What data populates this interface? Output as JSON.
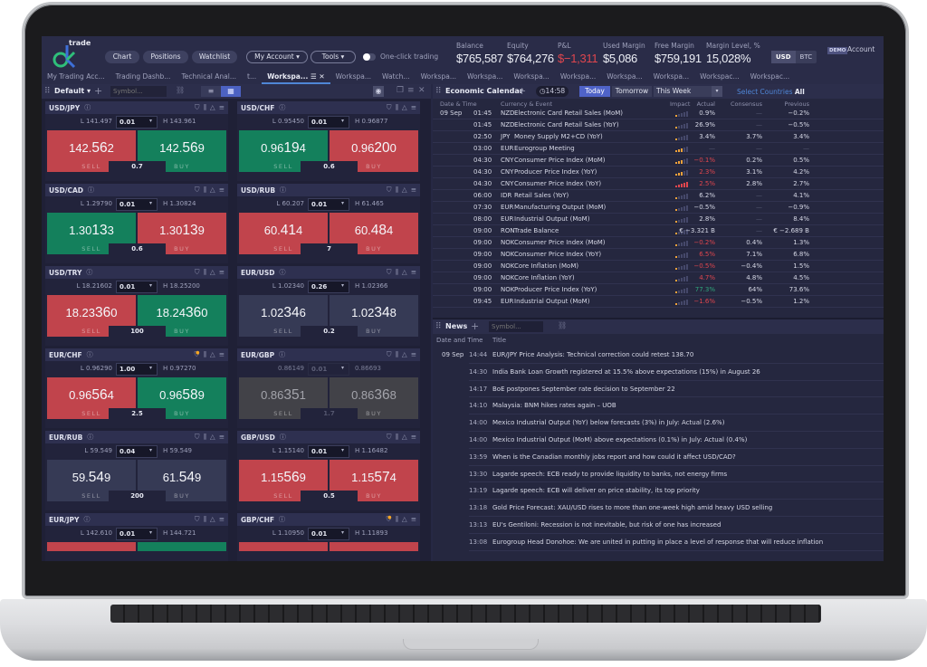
{
  "app": {
    "logo_text": "trade",
    "nav_buttons": [
      "Chart",
      "Positions",
      "Watchlist"
    ],
    "menus": [
      {
        "label": "My Account",
        "caret": "▾"
      },
      {
        "label": "Tools",
        "caret": "▾"
      }
    ],
    "one_click_label": "One-click trading",
    "one_click_enabled": false,
    "metrics": [
      {
        "label": "Balance",
        "value": "$765,587",
        "negative": false
      },
      {
        "label": "Equity",
        "value": "$764,276",
        "negative": false
      },
      {
        "label": "P&L",
        "value": "$−1,311",
        "negative": true
      },
      {
        "label": "Used Margin",
        "value": "$5,086",
        "negative": false
      },
      {
        "label": "Free Margin",
        "value": "$759,191",
        "negative": false
      },
      {
        "label": "Margin Level, %",
        "value": "15,028%",
        "negative": false
      }
    ],
    "currency_options": [
      "USD",
      "BTC"
    ],
    "currency_selected": "USD",
    "demo_badge": "DEMO",
    "account_label": "Account",
    "colors": {
      "accent": "#4f63c8",
      "buy_green": "#14805c",
      "sell_red": "#c1444c",
      "negative": "#e0464e",
      "positive": "#2fa77c",
      "impact": "#f0a23a"
    }
  },
  "tabs": [
    {
      "label": "My Trading Acc...",
      "active": false
    },
    {
      "label": "Trading Dashb...",
      "active": false
    },
    {
      "label": "Technical Anal...",
      "active": false
    },
    {
      "label": "t...",
      "active": false
    },
    {
      "label": "Workspa...",
      "active": true
    },
    {
      "label": "Workspa...",
      "active": false
    },
    {
      "label": "Watch...",
      "active": false
    },
    {
      "label": "Workspa...",
      "active": false
    },
    {
      "label": "Workspa...",
      "active": false
    },
    {
      "label": "Workspa...",
      "active": false
    },
    {
      "label": "Workspa...",
      "active": false
    },
    {
      "label": "Workspa...",
      "active": false
    },
    {
      "label": "Workspa...",
      "active": false
    },
    {
      "label": "Workspac...",
      "active": false
    },
    {
      "label": "Workspac...",
      "active": false
    }
  ],
  "watchlist": {
    "name": "Default",
    "symbol_placeholder": "Symbol...",
    "quotes": [
      {
        "pair": "USD/JPY",
        "low": "L 141.497",
        "high": "H 143.961",
        "qty": "0.01",
        "sell": [
          "142.",
          "56",
          "2"
        ],
        "buy": [
          "142.",
          "56",
          "9"
        ],
        "sell_color": "red",
        "buy_color": "green",
        "spread": "0.7",
        "alert_dot": false,
        "disabled": false
      },
      {
        "pair": "USD/CHF",
        "low": "L 0.95450",
        "high": "H 0.96877",
        "qty": "0.01",
        "sell": [
          "0.96",
          "19",
          "4"
        ],
        "buy": [
          "0.96",
          "20",
          "0"
        ],
        "sell_color": "green",
        "buy_color": "red",
        "spread": "0.6",
        "alert_dot": false,
        "disabled": false
      },
      {
        "pair": "USD/CAD",
        "low": "L 1.29790",
        "high": "H 1.30824",
        "qty": "0.01",
        "sell": [
          "1.30",
          "13",
          "3"
        ],
        "buy": [
          "1.30",
          "13",
          "9"
        ],
        "sell_color": "green",
        "buy_color": "red",
        "spread": "0.6",
        "alert_dot": false,
        "disabled": false
      },
      {
        "pair": "USD/RUB",
        "low": "L 60.207",
        "high": "H 61.465",
        "qty": "0.01",
        "sell": [
          "60.",
          "41",
          "4"
        ],
        "buy": [
          "60.",
          "48",
          "4"
        ],
        "sell_color": "red",
        "buy_color": "red",
        "spread": "7",
        "alert_dot": false,
        "disabled": false
      },
      {
        "pair": "USD/TRY",
        "low": "L 18.21602",
        "high": "H 18.25200",
        "qty": "0.01",
        "sell": [
          "18.23",
          "36",
          "0"
        ],
        "buy": [
          "18.24",
          "36",
          "0"
        ],
        "sell_color": "red",
        "buy_color": "green",
        "spread": "100",
        "alert_dot": false,
        "disabled": false
      },
      {
        "pair": "EUR/USD",
        "low": "L 1.02340",
        "high": "H 1.02366",
        "qty": "0.26",
        "sell": [
          "1.02",
          "34",
          "6"
        ],
        "buy": [
          "1.02",
          "34",
          "8"
        ],
        "sell_color": "neutral",
        "buy_color": "neutral",
        "spread": "0.2",
        "alert_dot": false,
        "disabled": false
      },
      {
        "pair": "EUR/CHF",
        "low": "L 0.96290",
        "high": "H 0.97270",
        "qty": "1.00",
        "sell": [
          "0.96",
          "56",
          "4"
        ],
        "buy": [
          "0.96",
          "58",
          "9"
        ],
        "sell_color": "red",
        "buy_color": "green",
        "spread": "2.5",
        "alert_dot": true,
        "disabled": false
      },
      {
        "pair": "EUR/GBP",
        "low": "0.86149",
        "high": "0.86693",
        "qty": "0.01",
        "sell": [
          "0.86",
          "35",
          "1"
        ],
        "buy": [
          "0.86",
          "36",
          "8"
        ],
        "sell_color": "grey",
        "buy_color": "grey",
        "spread": "1.7",
        "alert_dot": false,
        "disabled": true
      },
      {
        "pair": "EUR/RUB",
        "low": "L 59.549",
        "high": "H 59.549",
        "qty": "0.04",
        "sell": [
          "59.",
          "54",
          "9"
        ],
        "buy": [
          "61.",
          "54",
          "9"
        ],
        "sell_color": "neutral",
        "buy_color": "neutral",
        "spread": "200",
        "alert_dot": false,
        "disabled": false
      },
      {
        "pair": "GBP/USD",
        "low": "L 1.15140",
        "high": "H 1.16482",
        "qty": "0.01",
        "sell": [
          "1.15",
          "56",
          "9"
        ],
        "buy": [
          "1.15",
          "57",
          "4"
        ],
        "sell_color": "red",
        "buy_color": "red",
        "spread": "0.5",
        "alert_dot": false,
        "disabled": false
      },
      {
        "pair": "EUR/JPY",
        "low": "L 142.610",
        "high": "H 144.721",
        "qty": "0.01",
        "sell": [
          "",
          "",
          ""
        ],
        "buy": [
          "",
          "",
          ""
        ],
        "sell_color": "red",
        "buy_color": "green",
        "spread": "",
        "alert_dot": false,
        "disabled": false
      },
      {
        "pair": "GBP/CHF",
        "low": "L 1.10950",
        "high": "H 1.11893",
        "qty": "0.01",
        "sell": [
          "",
          "",
          ""
        ],
        "buy": [
          "",
          "",
          ""
        ],
        "sell_color": "red",
        "buy_color": "red",
        "spread": "",
        "alert_dot": true,
        "disabled": false
      }
    ],
    "sell_label": "SELL",
    "buy_label": "BUY"
  },
  "calendar": {
    "title": "Economic Calendar",
    "clock": "14:58",
    "ranges": [
      "Today",
      "Tomorrow"
    ],
    "range_selected": "Today",
    "week_select": "This Week",
    "select_countries_label": "Select Countries",
    "select_countries_value": "All",
    "columns": [
      "Date & Time",
      "Currency & Event",
      "Impact",
      "Actual",
      "Consensus",
      "Previous"
    ],
    "rows": [
      {
        "date": "09 Sep",
        "time": "01:45",
        "cur": "NZD",
        "event": "Electronic Card Retail Sales (MoM)",
        "impact": 1,
        "actual": "0.9%",
        "actual_tone": "",
        "consensus": "—",
        "previous": "−0.2%"
      },
      {
        "date": "",
        "time": "01:45",
        "cur": "NZD",
        "event": "Electronic Card Retail Sales (YoY)",
        "impact": 1,
        "actual": "26.9%",
        "actual_tone": "",
        "consensus": "—",
        "previous": "−0.5%"
      },
      {
        "date": "",
        "time": "02:50",
        "cur": "JPY",
        "event": "Money Supply M2+CD (YoY)",
        "impact": 1,
        "actual": "3.4%",
        "actual_tone": "",
        "consensus": "3.7%",
        "previous": "3.4%"
      },
      {
        "date": "",
        "time": "03:00",
        "cur": "EUR",
        "event": "Eurogroup Meeting",
        "impact": 2,
        "actual": "—",
        "actual_tone": "dash",
        "consensus": "—",
        "previous": "—"
      },
      {
        "date": "",
        "time": "04:30",
        "cur": "CNY",
        "event": "Consumer Price Index (MoM)",
        "impact": 2,
        "actual": "−0.1%",
        "actual_tone": "neg",
        "consensus": "0.2%",
        "previous": "0.5%"
      },
      {
        "date": "",
        "time": "04:30",
        "cur": "CNY",
        "event": "Producer Price Index (YoY)",
        "impact": 2,
        "actual": "2.3%",
        "actual_tone": "neg",
        "consensus": "3.1%",
        "previous": "4.2%"
      },
      {
        "date": "",
        "time": "04:30",
        "cur": "CNY",
        "event": "Consumer Price Index (YoY)",
        "impact": 3,
        "actual": "2.5%",
        "actual_tone": "neg",
        "consensus": "2.8%",
        "previous": "2.7%"
      },
      {
        "date": "",
        "time": "06:00",
        "cur": "IDR",
        "event": "Retail Sales (YoY)",
        "impact": 1,
        "actual": "6.2%",
        "actual_tone": "",
        "consensus": "—",
        "previous": "4.1%"
      },
      {
        "date": "",
        "time": "07:30",
        "cur": "EUR",
        "event": "Manufacturing Output (MoM)",
        "impact": 1,
        "actual": "−0.5%",
        "actual_tone": "",
        "consensus": "—",
        "previous": "−0.9%"
      },
      {
        "date": "",
        "time": "08:00",
        "cur": "EUR",
        "event": "Industrial Output (MoM)",
        "impact": 1,
        "actual": "2.8%",
        "actual_tone": "",
        "consensus": "—",
        "previous": "8.4%"
      },
      {
        "date": "",
        "time": "09:00",
        "cur": "RON",
        "event": "Trade Balance",
        "impact": 1,
        "actual": "€ −3.321 B",
        "actual_tone": "",
        "consensus": "—",
        "previous": "€ −2.689 B"
      },
      {
        "date": "",
        "time": "09:00",
        "cur": "NOK",
        "event": "Consumer Price Index (MoM)",
        "impact": 1,
        "actual": "−0.2%",
        "actual_tone": "neg",
        "consensus": "0.4%",
        "previous": "1.3%"
      },
      {
        "date": "",
        "time": "09:00",
        "cur": "NOK",
        "event": "Consumer Price Index (YoY)",
        "impact": 1,
        "actual": "6.5%",
        "actual_tone": "neg",
        "consensus": "7.1%",
        "previous": "6.8%"
      },
      {
        "date": "",
        "time": "09:00",
        "cur": "NOK",
        "event": "Core Inflation (MoM)",
        "impact": 1,
        "actual": "−0.5%",
        "actual_tone": "neg",
        "consensus": "−0.4%",
        "previous": "1.5%"
      },
      {
        "date": "",
        "time": "09:00",
        "cur": "NOK",
        "event": "Core Inflation (YoY)",
        "impact": 1,
        "actual": "4.7%",
        "actual_tone": "neg",
        "consensus": "4.8%",
        "previous": "4.5%"
      },
      {
        "date": "",
        "time": "09:00",
        "cur": "NOK",
        "event": "Producer Price Index (YoY)",
        "impact": 1,
        "actual": "77.3%",
        "actual_tone": "pos",
        "consensus": "64%",
        "previous": "73.6%"
      },
      {
        "date": "",
        "time": "09:45",
        "cur": "EUR",
        "event": "Industrial Output (MoM)",
        "impact": 1,
        "actual": "−1.6%",
        "actual_tone": "neg",
        "consensus": "−0.5%",
        "previous": "1.2%"
      }
    ]
  },
  "news": {
    "title": "News",
    "symbol_placeholder": "Symbol...",
    "columns": [
      "Date and Time",
      "Title"
    ],
    "rows": [
      {
        "date": "09 Sep",
        "time": "14:44",
        "title": "EUR/JPY Price Analysis: Technical correction could retest 138.70"
      },
      {
        "date": "",
        "time": "14:30",
        "title": "India Bank Loan Growth registered at 15.5% above expectations (15%) in August 26"
      },
      {
        "date": "",
        "time": "14:17",
        "title": "BoE postpones September rate decision to September 22"
      },
      {
        "date": "",
        "time": "14:10",
        "title": "Malaysia: BNM hikes rates again – UOB"
      },
      {
        "date": "",
        "time": "14:00",
        "title": "Mexico Industrial Output (YoY) below forecasts (3%) in July: Actual (2.6%)"
      },
      {
        "date": "",
        "time": "14:00",
        "title": "Mexico Industrial Output (MoM) above expectations (0.1%) in July: Actual (0.4%)"
      },
      {
        "date": "",
        "time": "13:59",
        "title": "When is the Canadian monthly jobs report and how could it affect USD/CAD?"
      },
      {
        "date": "",
        "time": "13:30",
        "title": "Lagarde speech: ECB ready to provide liquidity to banks, not energy firms"
      },
      {
        "date": "",
        "time": "13:19",
        "title": "Lagarde speech: ECB will deliver on price stability, its top priority"
      },
      {
        "date": "",
        "time": "13:18",
        "title": "Gold Price Forecast: XAU/USD rises to more than one-week high amid heavy USD selling"
      },
      {
        "date": "",
        "time": "13:13",
        "title": "EU's Gentiloni: Recession is not inevitable, but risk of one has increased"
      },
      {
        "date": "",
        "time": "13:08",
        "title": "Eurogroup Head Donohoe: We are united in putting in place a level of response that will reduce inflation"
      }
    ]
  }
}
